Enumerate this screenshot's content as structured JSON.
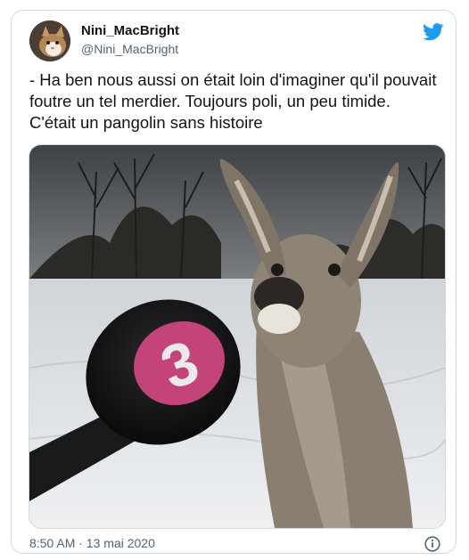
{
  "author": {
    "name": "Nini_MacBright",
    "handle": "@Nini_MacBright"
  },
  "tweet": {
    "text": "- Ha ben nous aussi on était loin d'imaginer qu'il pouvait foutre un tel merdier. Toujours poli, un peu timide. C'était un pangolin sans histoire"
  },
  "media": {
    "microphone_logo_text": "3"
  },
  "meta": {
    "timestamp": "8:50 AM · 13 mai 2020"
  },
  "icons": {
    "brand": "twitter-bird-icon",
    "info": "info-icon"
  },
  "colors": {
    "brand_blue": "#1d9bf0",
    "mic_pink": "#c4447a"
  }
}
